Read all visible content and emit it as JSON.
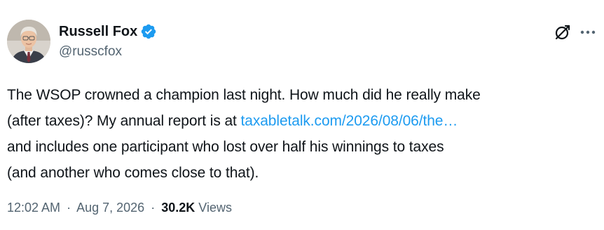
{
  "author": {
    "display_name": "Russell Fox",
    "handle": "@russcfox",
    "verified": true
  },
  "tweet": {
    "text_line1": "The WSOP crowned a champion last night. How much did he really make",
    "text_line2_prefix": "(after taxes)? My annual report is at ",
    "link_text": "taxabletalk.com/2026/08/06/the…",
    "text_line3": "and includes one participant who lost over half his winnings to taxes",
    "text_line4": "(and another who comes close to that)."
  },
  "meta": {
    "time": "12:02 AM",
    "separator": "·",
    "date": "Aug 7, 2026",
    "views_count": "30.2K",
    "views_label": "Views"
  },
  "icons": {
    "verified": "verified-badge-icon",
    "grok": "grok-icon",
    "more": "more-options-icon"
  },
  "colors": {
    "link": "#1d9bf0",
    "verified": "#1d9bf0",
    "secondary_text": "#536471",
    "primary_text": "#0f1419"
  }
}
